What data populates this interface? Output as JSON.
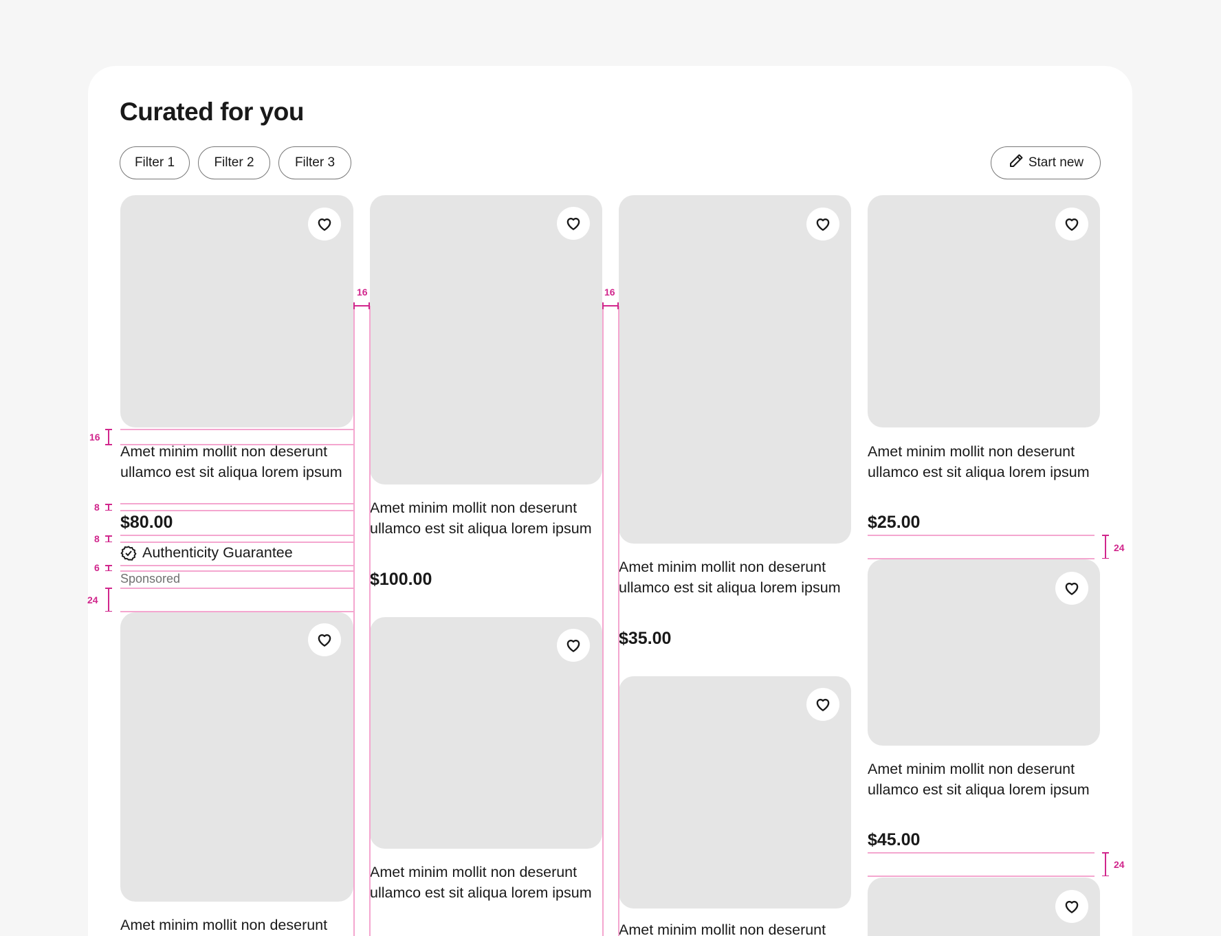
{
  "header": {
    "title": "Curated for you",
    "filters": [
      "Filter 1",
      "Filter 2",
      "Filter 3"
    ],
    "start_new_label": "Start new"
  },
  "items": [
    {
      "title": "Amet minim mollit non deserunt ullamco est sit aliqua lorem ipsum",
      "price": "$80.00",
      "badge": "Authenticity Guarantee",
      "sponsored": "Sponsored"
    },
    {
      "title": "Amet minim mollit non deserunt",
      "price": ""
    },
    {
      "title": "Amet minim mollit non deserunt ullamco est sit aliqua lorem ipsum",
      "price": "$100.00"
    },
    {
      "title": "Amet minim mollit non deserunt ullamco est sit aliqua lorem ipsum",
      "price": ""
    },
    {
      "title": "Amet minim mollit non deserunt ullamco est sit aliqua lorem ipsum",
      "price": "$35.00"
    },
    {
      "title": "Amet minim mollit non deserunt",
      "price": ""
    },
    {
      "title": "Amet minim mollit non deserunt ullamco est sit aliqua lorem ipsum",
      "price": "$25.00"
    },
    {
      "title": "Amet minim mollit non deserunt ullamco est sit aliqua lorem ipsum",
      "price": "$45.00"
    }
  ],
  "spec_labels": {
    "gap_16": "16",
    "gap_8": "8",
    "gap_6": "6",
    "gap_24": "24"
  },
  "icons": {
    "favorite": "heart-icon",
    "verified": "check-badge-icon",
    "edit": "pencil-icon"
  },
  "colors": {
    "spec_accent": "#d1268c",
    "image_placeholder": "#e5e5e5"
  }
}
